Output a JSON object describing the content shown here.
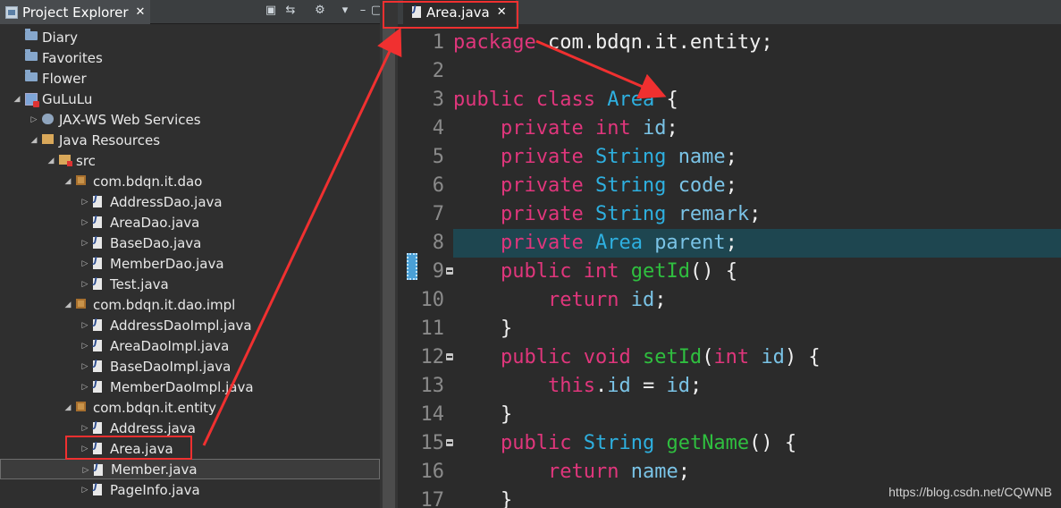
{
  "explorer": {
    "title": "Project Explorer",
    "close": "✕",
    "toolbar": [
      "collapse-all-icon",
      "link-with-editor-icon",
      "filter-icon",
      "view-menu-icon",
      "minimize-icon",
      "maximize-icon"
    ],
    "tree": [
      {
        "label": "Diary",
        "icon": "folder-icon",
        "twisty": ""
      },
      {
        "label": "Favorites",
        "icon": "folder-icon",
        "twisty": ""
      },
      {
        "label": "Flower",
        "icon": "folder-icon",
        "twisty": ""
      },
      {
        "label": "GuLuLu",
        "icon": "project-icon",
        "twisty": "open"
      },
      {
        "label": "JAX-WS Web Services",
        "icon": "webservice-icon",
        "twisty": "closed"
      },
      {
        "label": "Java Resources",
        "icon": "java-resources-icon",
        "twisty": "open"
      },
      {
        "label": "src",
        "icon": "source-folder-icon",
        "twisty": "open"
      },
      {
        "label": "com.bdqn.it.dao",
        "icon": "package-icon",
        "twisty": "open"
      },
      {
        "label": "AddressDao.java",
        "icon": "java-file-icon",
        "twisty": "closed"
      },
      {
        "label": "AreaDao.java",
        "icon": "java-file-icon",
        "twisty": "closed"
      },
      {
        "label": "BaseDao.java",
        "icon": "java-file-icon",
        "twisty": "closed"
      },
      {
        "label": "MemberDao.java",
        "icon": "java-file-icon",
        "twisty": "closed"
      },
      {
        "label": "Test.java",
        "icon": "java-file-icon",
        "twisty": "closed"
      },
      {
        "label": "com.bdqn.it.dao.impl",
        "icon": "package-icon",
        "twisty": "open"
      },
      {
        "label": "AddressDaoImpl.java",
        "icon": "java-file-icon",
        "twisty": "closed"
      },
      {
        "label": "AreaDaoImpl.java",
        "icon": "java-file-icon",
        "twisty": "closed"
      },
      {
        "label": "BaseDaoImpl.java",
        "icon": "java-file-icon",
        "twisty": "closed"
      },
      {
        "label": "MemberDaoImpl.java",
        "icon": "java-file-icon",
        "twisty": "closed"
      },
      {
        "label": "com.bdqn.it.entity",
        "icon": "package-icon",
        "twisty": "open"
      },
      {
        "label": "Address.java",
        "icon": "java-file-icon",
        "twisty": "closed"
      },
      {
        "label": "Area.java",
        "icon": "java-file-icon",
        "twisty": "closed"
      },
      {
        "label": "Member.java",
        "icon": "java-file-icon",
        "twisty": "closed",
        "selected": true
      },
      {
        "label": "PageInfo.java",
        "icon": "java-file-icon",
        "twisty": "closed"
      }
    ]
  },
  "editor": {
    "tab_title": "Area.java",
    "tab_close": "✕",
    "lines": [
      {
        "n": "1",
        "tokens": [
          [
            "k",
            "package"
          ],
          [
            "p",
            " com.bdqn.it.entity;"
          ]
        ]
      },
      {
        "n": "2",
        "tokens": []
      },
      {
        "n": "3",
        "tokens": [
          [
            "k",
            "public"
          ],
          [
            "p",
            " "
          ],
          [
            "k",
            "class"
          ],
          [
            "p",
            " "
          ],
          [
            "t",
            "Area"
          ],
          [
            "p",
            " {"
          ]
        ]
      },
      {
        "n": "4",
        "tokens": [
          [
            "p",
            "    "
          ],
          [
            "k",
            "private"
          ],
          [
            "p",
            " "
          ],
          [
            "k",
            "int"
          ],
          [
            "p",
            " "
          ],
          [
            "v",
            "id"
          ],
          [
            "p",
            ";"
          ]
        ]
      },
      {
        "n": "5",
        "tokens": [
          [
            "p",
            "    "
          ],
          [
            "k",
            "private"
          ],
          [
            "p",
            " "
          ],
          [
            "t",
            "String"
          ],
          [
            "p",
            " "
          ],
          [
            "v",
            "name"
          ],
          [
            "p",
            ";"
          ]
        ]
      },
      {
        "n": "6",
        "tokens": [
          [
            "p",
            "    "
          ],
          [
            "k",
            "private"
          ],
          [
            "p",
            " "
          ],
          [
            "t",
            "String"
          ],
          [
            "p",
            " "
          ],
          [
            "v",
            "code"
          ],
          [
            "p",
            ";"
          ]
        ]
      },
      {
        "n": "7",
        "tokens": [
          [
            "p",
            "    "
          ],
          [
            "k",
            "private"
          ],
          [
            "p",
            " "
          ],
          [
            "t",
            "String"
          ],
          [
            "p",
            " "
          ],
          [
            "v",
            "remark"
          ],
          [
            "p",
            ";"
          ]
        ]
      },
      {
        "n": "8",
        "tokens": [
          [
            "p",
            "    "
          ],
          [
            "k",
            "private"
          ],
          [
            "p",
            " "
          ],
          [
            "t",
            "Area"
          ],
          [
            "p",
            " "
          ],
          [
            "v",
            "parent"
          ],
          [
            "p",
            ";"
          ]
        ],
        "highlight": true
      },
      {
        "n": "9",
        "tokens": [
          [
            "p",
            "    "
          ],
          [
            "k",
            "public"
          ],
          [
            "p",
            " "
          ],
          [
            "k",
            "int"
          ],
          [
            "p",
            " "
          ],
          [
            "f",
            "getId"
          ],
          [
            "p",
            "() {"
          ]
        ],
        "fold": true
      },
      {
        "n": "10",
        "tokens": [
          [
            "p",
            "        "
          ],
          [
            "k",
            "return"
          ],
          [
            "p",
            " "
          ],
          [
            "v",
            "id"
          ],
          [
            "p",
            ";"
          ]
        ]
      },
      {
        "n": "11",
        "tokens": [
          [
            "p",
            "    }"
          ]
        ]
      },
      {
        "n": "12",
        "tokens": [
          [
            "p",
            "    "
          ],
          [
            "k",
            "public"
          ],
          [
            "p",
            " "
          ],
          [
            "k",
            "void"
          ],
          [
            "p",
            " "
          ],
          [
            "f",
            "setId"
          ],
          [
            "p",
            "("
          ],
          [
            "k",
            "int"
          ],
          [
            "p",
            " "
          ],
          [
            "v",
            "id"
          ],
          [
            "p",
            ") {"
          ]
        ],
        "fold": true
      },
      {
        "n": "13",
        "tokens": [
          [
            "p",
            "        "
          ],
          [
            "k",
            "this"
          ],
          [
            "p",
            "."
          ],
          [
            "v",
            "id"
          ],
          [
            "p",
            " = "
          ],
          [
            "v",
            "id"
          ],
          [
            "p",
            ";"
          ]
        ]
      },
      {
        "n": "14",
        "tokens": [
          [
            "p",
            "    }"
          ]
        ]
      },
      {
        "n": "15",
        "tokens": [
          [
            "p",
            "    "
          ],
          [
            "k",
            "public"
          ],
          [
            "p",
            " "
          ],
          [
            "t",
            "String"
          ],
          [
            "p",
            " "
          ],
          [
            "f",
            "getName"
          ],
          [
            "p",
            "() {"
          ]
        ],
        "fold": true
      },
      {
        "n": "16",
        "tokens": [
          [
            "p",
            "        "
          ],
          [
            "k",
            "return"
          ],
          [
            "p",
            " "
          ],
          [
            "v",
            "name"
          ],
          [
            "p",
            ";"
          ]
        ]
      },
      {
        "n": "17",
        "tokens": [
          [
            "p",
            "    }"
          ]
        ]
      }
    ]
  },
  "watermark": "https://blog.csdn.net/CQWNB",
  "colors": {
    "keyword": "#e0367c",
    "type": "#2eb0e0",
    "method": "#2fbf3f",
    "variable": "#7ac3e6",
    "annotation": "#f03030",
    "line_highlight": "#1e4650"
  }
}
